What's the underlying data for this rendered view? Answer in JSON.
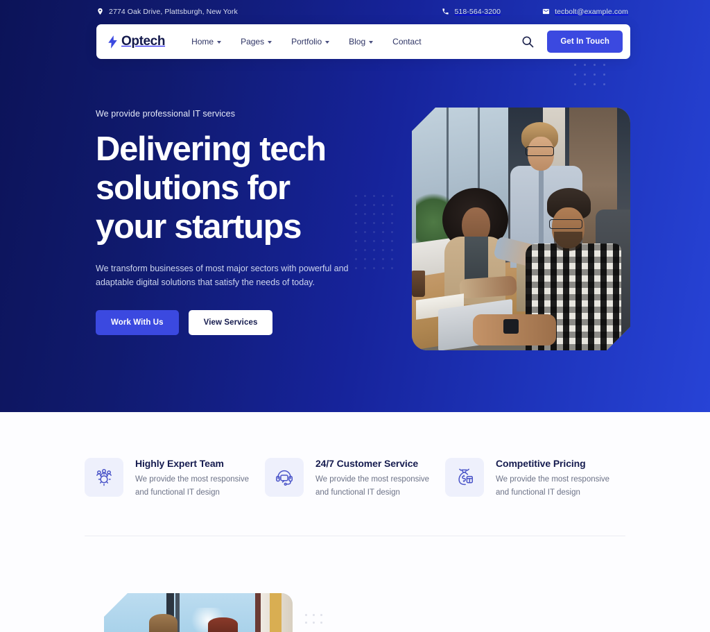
{
  "topbar": {
    "address": "2774 Oak Drive, Plattsburgh, New York",
    "phone": "518-564-3200",
    "email": "tecbolt@example.com",
    "location_icon": "location-pin-icon",
    "phone_icon": "phone-icon",
    "email_icon": "envelope-icon"
  },
  "navbar": {
    "logo_text": "Optech",
    "logo_icon": "lightning-bolt-icon",
    "items": [
      {
        "label": "Home",
        "has_dropdown": true
      },
      {
        "label": "Pages",
        "has_dropdown": true
      },
      {
        "label": "Portfolio",
        "has_dropdown": true
      },
      {
        "label": "Blog",
        "has_dropdown": true
      },
      {
        "label": "Contact",
        "has_dropdown": false
      }
    ],
    "search_icon": "search-icon",
    "cta_label": "Get In Touch"
  },
  "hero": {
    "eyebrow": "We provide professional IT services",
    "heading_line1": "Delivering tech",
    "heading_line2": "solutions for",
    "heading_line3": "your startups",
    "paragraph": "We transform businesses of most major sectors with powerful and adaptable digital solutions that satisfy the needs of today.",
    "primary_button": "Work With Us",
    "secondary_button": "View Services",
    "image_alt": "three colleagues collaborating at an office desk with a laptop"
  },
  "features": [
    {
      "icon": "team-gear-icon",
      "title": "Highly Expert Team",
      "desc_line1": "We provide the most responsive",
      "desc_line2": "and functional IT design"
    },
    {
      "icon": "headset-support-icon",
      "title": "24/7 Customer Service",
      "desc_line1": "We provide the most responsive",
      "desc_line2": "and functional IT design"
    },
    {
      "icon": "money-bag-icon",
      "title": "Competitive Pricing",
      "desc_line1": "We provide the most responsive",
      "desc_line2": "and functional IT design"
    }
  ],
  "bottom_section": {
    "image_alt": "two people standing by a glass office window"
  },
  "colors": {
    "accent_blue": "#3b49e0",
    "hero_gradient_start": "#0c1358",
    "hero_gradient_end": "#2743d6",
    "heading_navy": "#161c4f",
    "icon_tile_bg": "#eef0fc",
    "body_text": "#6c7287"
  }
}
